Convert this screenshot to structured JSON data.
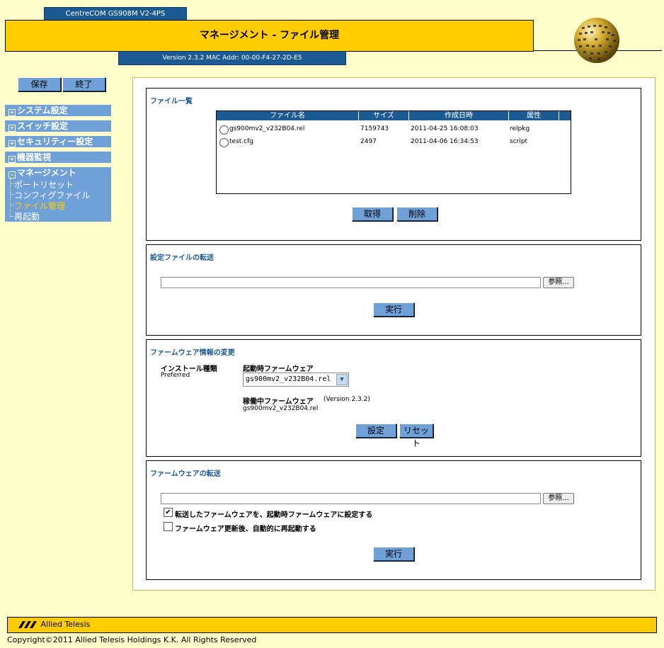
{
  "header": {
    "model": "CentreCOM GS908M V2-4PS",
    "title": "マネージメント - ファイル管理",
    "version": "Version 2.3.2 MAC Addr: 00-00-F4-27-2D-E5"
  },
  "sidebar": {
    "save_label": "保存",
    "exit_label": "終了",
    "items": [
      {
        "label": "システム設定",
        "expander": "+"
      },
      {
        "label": "スイッチ設定",
        "expander": "+"
      },
      {
        "label": "セキュリティー設定",
        "expander": "+"
      },
      {
        "label": "機器監視",
        "expander": "+"
      },
      {
        "label": "マネージメント",
        "expander": "-"
      }
    ],
    "sub_items": [
      "ポートリセット",
      "コンフィグファイル",
      "ファイル管理",
      "再起動"
    ]
  },
  "file_list": {
    "title": "ファイル一覧",
    "columns": [
      "ファイル名",
      "サイズ",
      "作成日時",
      "属性"
    ],
    "rows": [
      {
        "name": "gs900mv2_v232B04.rel",
        "size": "7159743",
        "date": "2011-04-25 16:08:03",
        "attr": "relpkg"
      },
      {
        "name": "test.cfg",
        "size": "2497",
        "date": "2011-04-06 16:34:53",
        "attr": "script"
      }
    ],
    "get_label": "取得",
    "delete_label": "削除"
  },
  "config_transfer": {
    "title": "設定ファイルの転送",
    "path_value": "",
    "browse_label": "参照...",
    "execute_label": "実行"
  },
  "firmware_info": {
    "title": "ファームウェア情報の変更",
    "install_type_label": "インストール種類",
    "install_type_value": "Preferred",
    "boot_label": "起動時ファームウェア",
    "boot_selected": "gs900mv2_v232B04.rel",
    "running_label": "稼働中ファームウェア",
    "running_version": "(Version 2.3.2)",
    "running_value": "gs900mv2_v232B04.rel",
    "set_label": "設定",
    "reset_label": "リセット"
  },
  "firmware_transfer": {
    "title": "ファームウェアの転送",
    "path_value": "",
    "browse_label": "参照...",
    "option1_label": "転送したファームウェアを、起動時ファームウェアに設定する",
    "option1_checked": true,
    "option2_label": "ファームウェア更新後、自動的に再起動する",
    "option2_checked": false,
    "execute_label": "実行"
  },
  "footer": {
    "brand": "Allied Telesis",
    "copyright": "Copyright©2011 Allied Telesis Holdings K.K. All Rights Reserved"
  }
}
